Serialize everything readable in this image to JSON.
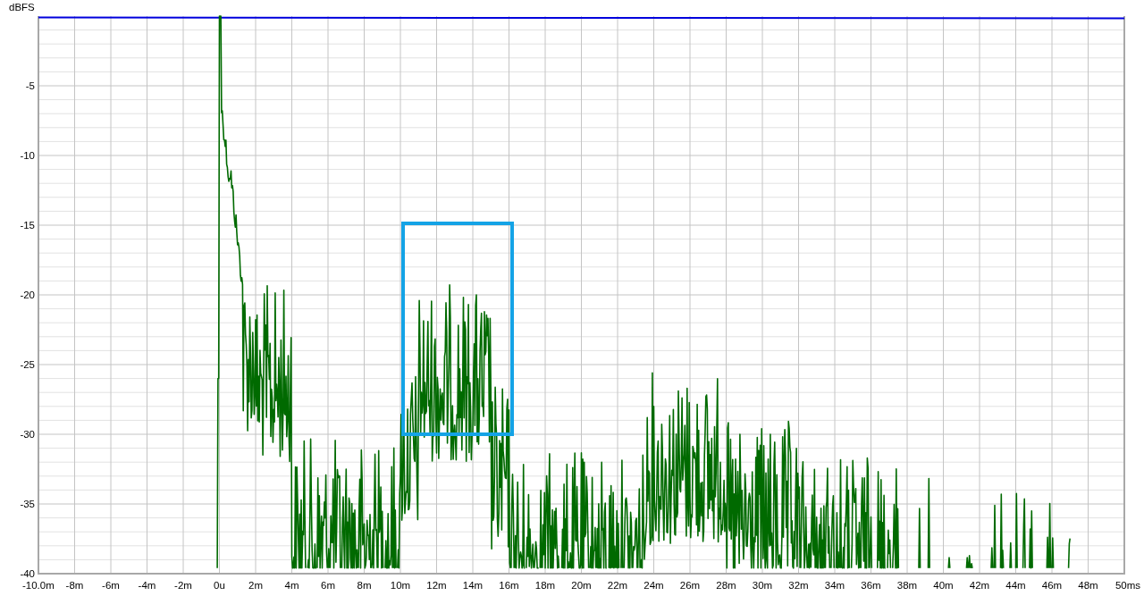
{
  "chart": {
    "y_unit": "dBFS",
    "y_ticks": [
      "-5",
      "-10",
      "-15",
      "-20",
      "-25",
      "-30",
      "-35",
      "-40"
    ],
    "x_ticks": [
      "-10.0m",
      "-8m",
      "-6m",
      "-4m",
      "-2m",
      "0u",
      "2m",
      "4m",
      "6m",
      "8m",
      "10m",
      "12m",
      "14m",
      "16m",
      "18m",
      "20m",
      "22m",
      "24m",
      "26m",
      "28m",
      "30m",
      "32m",
      "34m",
      "36m",
      "38m",
      "40m",
      "42m",
      "44m",
      "46m",
      "48m",
      "50ms"
    ]
  }
}
